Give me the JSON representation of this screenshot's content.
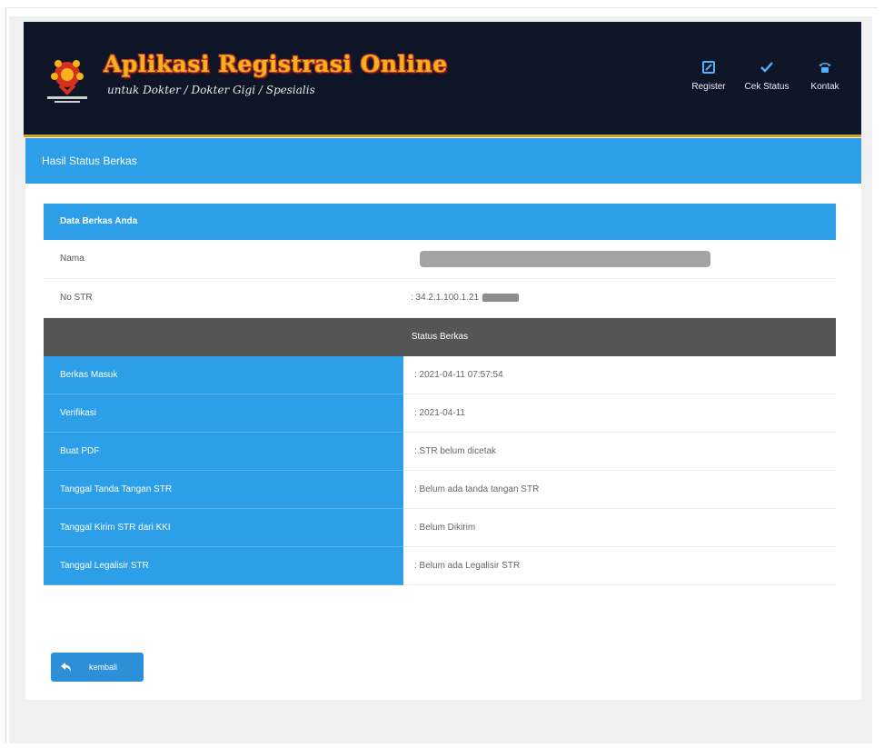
{
  "header": {
    "title": "Aplikasi Registrasi Online",
    "subtitle": "untuk Dokter / Dokter Gigi / Spesialis",
    "nav": [
      {
        "label": "Register",
        "icon": "edit-icon"
      },
      {
        "label": "Cek Status",
        "icon": "check-icon"
      },
      {
        "label": "Kontak",
        "icon": "phone-icon"
      }
    ]
  },
  "panel": {
    "title": "Hasil Status Berkas"
  },
  "data_section": {
    "title": "Data Berkas Anda",
    "rows": [
      {
        "label": "Nama",
        "value": ""
      },
      {
        "label": "No STR",
        "value": ": 34.2.1.100.1.21"
      }
    ]
  },
  "status_section": {
    "title": "Status Berkas",
    "rows": [
      {
        "label": "Berkas Masuk",
        "value": ": 2021-04-11 07:57:54"
      },
      {
        "label": "Verifikasi",
        "value": ": 2021-04-11"
      },
      {
        "label": "Buat PDF",
        "value": ": STR belum dicetak"
      },
      {
        "label": "Tanggal Tanda Tangan STR",
        "value": ": Belum ada tanda tangan STR"
      },
      {
        "label": "Tanggal Kirim STR dari KKI",
        "value": ": Belum Dikirim"
      },
      {
        "label": "Tanggal Legalisir STR",
        "value": ": Belum ada Legalisir STR"
      }
    ]
  },
  "actions": {
    "back_label": "kembali"
  },
  "colors": {
    "header_bg": "#0e1526",
    "accent_blue": "#2d9ee8",
    "status_bar": "#555555",
    "title_gold": "#f5b21a"
  }
}
